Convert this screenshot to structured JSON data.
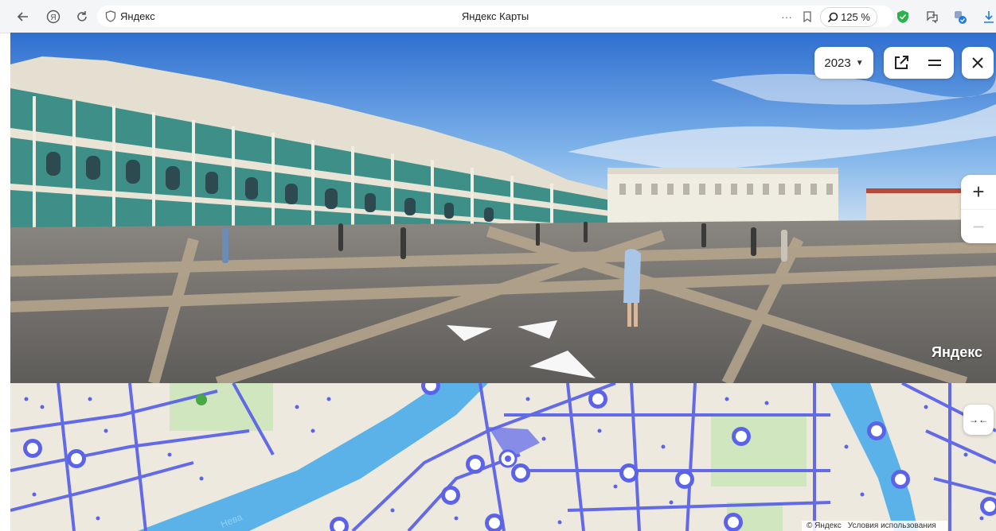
{
  "browser": {
    "back_icon": "arrow-left-icon",
    "yandex_icon": "yandex-logo-icon",
    "reload_icon": "reload-icon",
    "address_domain": "Яндекс",
    "page_title": "Яндекс Карты",
    "zoom_level": "125 %",
    "extension_icons": [
      "more-icon",
      "bookmark-icon",
      "search-icon",
      "shield-icon",
      "translate-icon",
      "extension-icon",
      "download-icon"
    ]
  },
  "panorama": {
    "year": "2023",
    "watermark": "Яндекс",
    "zoom_in": "+",
    "zoom_out": "−"
  },
  "map": {
    "collapse_label": "→←",
    "copyright": "© Яндекс",
    "terms": "Условия использования",
    "river_label": "Нева"
  },
  "colors": {
    "chrome_bg": "#f4f5f7",
    "coverage_blue": "#5b64e8",
    "river": "#5bb2e8",
    "map_bg": "#eee9df"
  }
}
